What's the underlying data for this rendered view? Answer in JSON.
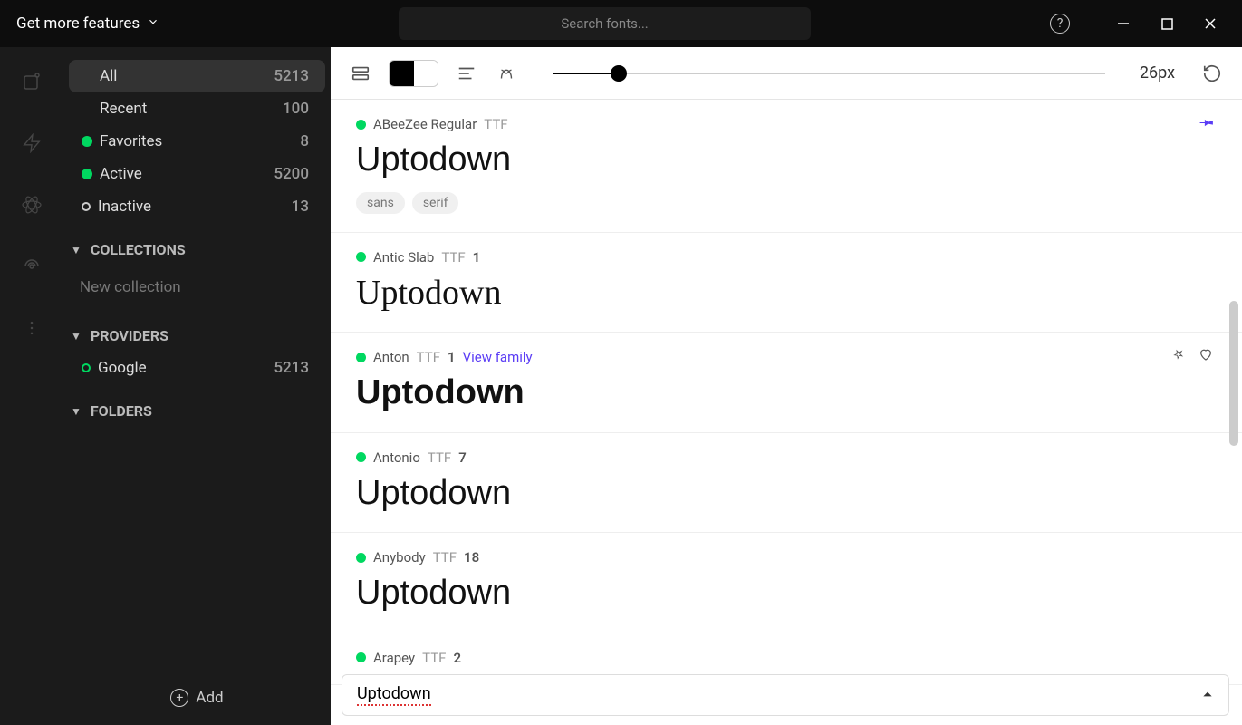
{
  "titlebar": {
    "features_label": "Get more features",
    "search_placeholder": "Search fonts..."
  },
  "sidebar": {
    "filters": {
      "all": {
        "label": "All",
        "count": "5213"
      },
      "recent": {
        "label": "Recent",
        "count": "100"
      },
      "favorites": {
        "label": "Favorites",
        "count": "8"
      },
      "active": {
        "label": "Active",
        "count": "5200"
      },
      "inactive": {
        "label": "Inactive",
        "count": "13"
      }
    },
    "collections_header": "COLLECTIONS",
    "new_collection": "New collection",
    "providers_header": "PROVIDERS",
    "providers": {
      "google": {
        "label": "Google",
        "count": "5213"
      }
    },
    "folders_header": "FOLDERS",
    "add_label": "Add"
  },
  "toolbar": {
    "size_label": "26px"
  },
  "fonts": [
    {
      "name": "ABeeZee Regular",
      "type": "TTF",
      "count": "",
      "preview": "Uptodown",
      "tags": [
        "sans",
        "serif"
      ],
      "pinned": true,
      "pvclass": "pv-abeezee"
    },
    {
      "name": "Antic Slab",
      "type": "TTF",
      "count": "1",
      "preview": "Uptodown",
      "tags": [],
      "pvclass": "pv-antic"
    },
    {
      "name": "Anton",
      "type": "TTF",
      "count": "1",
      "preview": "Uptodown",
      "link": "View family",
      "actions": true,
      "pvclass": "pv-anton"
    },
    {
      "name": "Antonio",
      "type": "TTF",
      "count": "7",
      "preview": "Uptodown",
      "pvclass": "pv-antonio"
    },
    {
      "name": "Anybody",
      "type": "TTF",
      "count": "18",
      "preview": "Uptodown",
      "pvclass": "pv-anybody"
    },
    {
      "name": "Arapey",
      "type": "TTF",
      "count": "2",
      "preview": "",
      "pvclass": ""
    }
  ],
  "preview_bar": {
    "text": "Uptodown"
  }
}
